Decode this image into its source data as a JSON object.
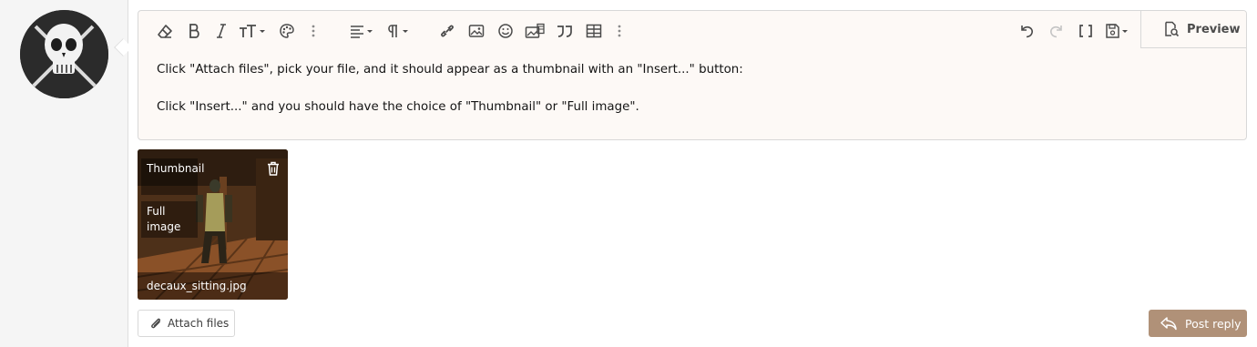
{
  "editor": {
    "toolbar": {
      "icons": [
        "eraser-icon",
        "bold-icon",
        "italic-icon",
        "text-size-icon",
        "palette-icon",
        "more-vertical-icon",
        "align-icon",
        "paragraph-icon",
        "link-icon",
        "image-icon",
        "smile-icon",
        "media-icon",
        "quote-icon",
        "table-icon",
        "more-vertical-icon",
        "undo-icon",
        "redo-icon",
        "brackets-icon",
        "save-draft-icon"
      ],
      "preview_label": "Preview"
    },
    "content": {
      "line1": "Click \"Attach files\", pick your file, and it should appear as a thumbnail with an \"Insert...\" button:",
      "line2": "Click \"Insert...\" and you should have the choice of \"Thumbnail\" or \"Full image\"."
    }
  },
  "attachment": {
    "option_thumbnail": "Thumbnail",
    "option_full": "Full image",
    "filename": "decaux_sitting.jpg"
  },
  "buttons": {
    "attach_files": "Attach files",
    "post_reply": "Post reply"
  },
  "colors": {
    "accent": "#b09178",
    "editor_bg": "#fdf9f6",
    "sidebar_bg": "#f5f5f5"
  }
}
